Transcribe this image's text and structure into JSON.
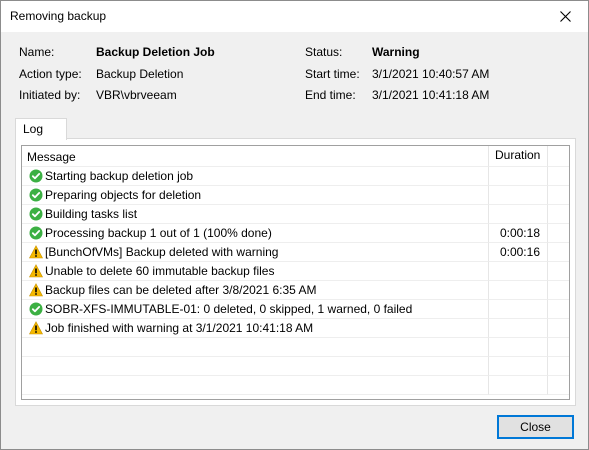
{
  "window": {
    "title": "Removing backup"
  },
  "info": {
    "name_label": "Name:",
    "name_value": "Backup Deletion Job",
    "action_label": "Action type:",
    "action_value": "Backup Deletion",
    "initiated_label": "Initiated by:",
    "initiated_value": "VBR\\vbrveeam",
    "status_label": "Status:",
    "status_value": "Warning",
    "start_label": "Start time:",
    "start_value": "3/1/2021 10:40:57 AM",
    "end_label": "End time:",
    "end_value": "3/1/2021 10:41:18 AM"
  },
  "tabs": [
    {
      "label": "Log"
    }
  ],
  "log": {
    "columns": [
      "Message",
      "Duration"
    ],
    "rows": [
      {
        "status": "success",
        "message": "Starting backup deletion job",
        "duration": ""
      },
      {
        "status": "success",
        "message": "Preparing objects for deletion",
        "duration": ""
      },
      {
        "status": "success",
        "message": "Building tasks list",
        "duration": ""
      },
      {
        "status": "success",
        "message": "Processing backup 1 out of 1 (100% done)",
        "duration": "0:00:18"
      },
      {
        "status": "warning",
        "message": "[BunchOfVMs] Backup deleted with warning",
        "duration": "0:00:16"
      },
      {
        "status": "warning",
        "message": "Unable to delete 60 immutable backup files",
        "duration": ""
      },
      {
        "status": "warning",
        "message": "Backup files can be deleted after 3/8/2021 6:35 AM",
        "duration": ""
      },
      {
        "status": "success",
        "message": "SOBR-XFS-IMMUTABLE-01: 0 deleted, 0 skipped, 1 warned, 0 failed",
        "duration": ""
      },
      {
        "status": "warning",
        "message": "Job finished with warning at 3/1/2021 10:41:18 AM",
        "duration": ""
      }
    ]
  },
  "buttons": {
    "close": "Close"
  },
  "colors": {
    "success": "#3cb043",
    "warning": "#f5b800",
    "accent": "#0078d7"
  },
  "icons": {
    "success": "check-circle-icon",
    "warning": "warning-triangle-icon",
    "close": "close-icon"
  }
}
